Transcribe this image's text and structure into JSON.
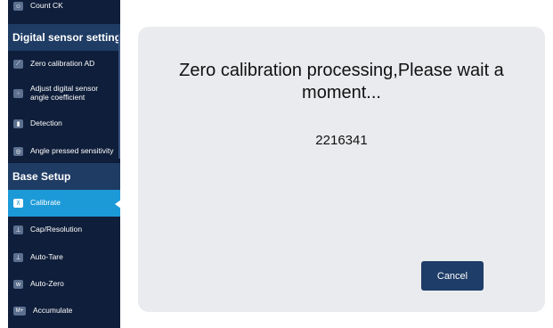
{
  "sidebar": {
    "top_item": {
      "label": "Count CK",
      "icon": "count-icon",
      "icon_glyph": "☺"
    },
    "sections": [
      {
        "header": "Digital sensor setting",
        "items": [
          {
            "label": "Zero calibration AD",
            "icon": "zero-calibration-icon",
            "icon_glyph": "⟋"
          },
          {
            "label": "Adjust digital sensor angle coefficient",
            "icon": "sensor-angle-icon",
            "icon_glyph": "⁘"
          },
          {
            "label": "Detection",
            "icon": "detection-icon",
            "icon_glyph": "▮"
          },
          {
            "label": "Angle pressed sensitivity",
            "icon": "sensitivity-icon",
            "icon_glyph": "◎"
          }
        ]
      },
      {
        "header": "Base Setup",
        "items": [
          {
            "label": "Calibrate",
            "icon": "calibrate-icon",
            "icon_glyph": "⊼",
            "active": true
          },
          {
            "label": "Cap/Resolution",
            "icon": "cap-resolution-icon",
            "icon_glyph": "⊥"
          },
          {
            "label": "Auto-Tare",
            "icon": "auto-tare-icon",
            "icon_glyph": "⊥"
          },
          {
            "label": "Auto-Zero",
            "icon": "auto-zero-icon",
            "icon_glyph": "w"
          },
          {
            "label": "Accumulate",
            "icon": "accumulate-icon",
            "icon_glyph": "M+"
          }
        ]
      }
    ]
  },
  "dialog": {
    "message": "Zero calibration processing,Please wait a moment...",
    "counter": "2216341",
    "cancel_label": "Cancel"
  },
  "colors": {
    "sidebar_bg": "#0f1e3a",
    "section_header_bg": "#1e3c64",
    "active_item_bg": "#1c9ad8",
    "dialog_bg": "#e9ebee",
    "button_bg": "#1e3d68"
  }
}
